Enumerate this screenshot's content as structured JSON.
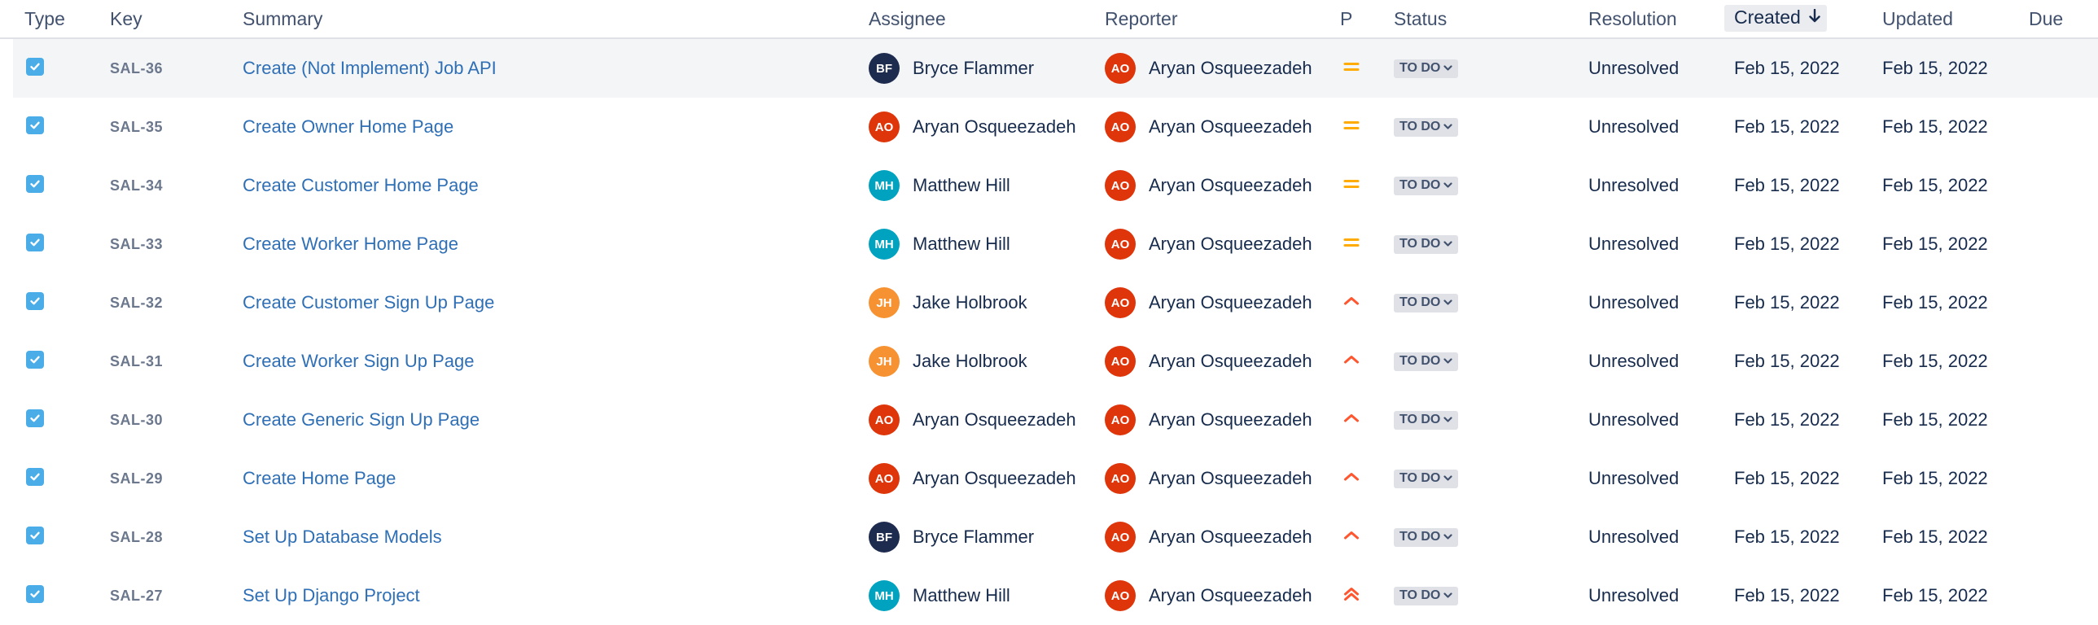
{
  "columns": {
    "type": "Type",
    "key": "Key",
    "summary": "Summary",
    "assignee": "Assignee",
    "reporter": "Reporter",
    "priority": "P",
    "status": "Status",
    "resolution": "Resolution",
    "created": "Created",
    "updated": "Updated",
    "due": "Due"
  },
  "sort": {
    "column": "created",
    "direction": "descending",
    "icon": "arrow-down-icon"
  },
  "colors": {
    "avatar_BF": "#1d2b4f",
    "avatar_AO": "#de350b",
    "avatar_MH": "#00a3bf",
    "avatar_JH": "#f79232",
    "priority_medium": "#ffab00",
    "priority_high": "#ff5630",
    "priority_highest": "#ff5630",
    "link": "#2f6fb5",
    "type_task": "#4bade8"
  },
  "issues": [
    {
      "type_icon": "task-checkbox-icon",
      "key": "SAL-36",
      "summary": "Create (Not Implement) Job API",
      "assignee": {
        "initials": "BF",
        "name": "Bryce Flammer"
      },
      "reporter": {
        "initials": "AO",
        "name": "Aryan Osqueezadeh"
      },
      "priority": "medium",
      "status": "TO DO",
      "resolution": "Unresolved",
      "created": "Feb 15, 2022",
      "updated": "Feb 15, 2022",
      "due": ""
    },
    {
      "type_icon": "task-checkbox-icon",
      "key": "SAL-35",
      "summary": "Create Owner Home Page",
      "assignee": {
        "initials": "AO",
        "name": "Aryan Osqueezadeh"
      },
      "reporter": {
        "initials": "AO",
        "name": "Aryan Osqueezadeh"
      },
      "priority": "medium",
      "status": "TO DO",
      "resolution": "Unresolved",
      "created": "Feb 15, 2022",
      "updated": "Feb 15, 2022",
      "due": ""
    },
    {
      "type_icon": "task-checkbox-icon",
      "key": "SAL-34",
      "summary": "Create Customer Home Page",
      "assignee": {
        "initials": "MH",
        "name": "Matthew Hill"
      },
      "reporter": {
        "initials": "AO",
        "name": "Aryan Osqueezadeh"
      },
      "priority": "medium",
      "status": "TO DO",
      "resolution": "Unresolved",
      "created": "Feb 15, 2022",
      "updated": "Feb 15, 2022",
      "due": ""
    },
    {
      "type_icon": "task-checkbox-icon",
      "key": "SAL-33",
      "summary": "Create Worker Home Page",
      "assignee": {
        "initials": "MH",
        "name": "Matthew Hill"
      },
      "reporter": {
        "initials": "AO",
        "name": "Aryan Osqueezadeh"
      },
      "priority": "medium",
      "status": "TO DO",
      "resolution": "Unresolved",
      "created": "Feb 15, 2022",
      "updated": "Feb 15, 2022",
      "due": ""
    },
    {
      "type_icon": "task-checkbox-icon",
      "key": "SAL-32",
      "summary": "Create Customer Sign Up Page",
      "assignee": {
        "initials": "JH",
        "name": "Jake Holbrook"
      },
      "reporter": {
        "initials": "AO",
        "name": "Aryan Osqueezadeh"
      },
      "priority": "high",
      "status": "TO DO",
      "resolution": "Unresolved",
      "created": "Feb 15, 2022",
      "updated": "Feb 15, 2022",
      "due": ""
    },
    {
      "type_icon": "task-checkbox-icon",
      "key": "SAL-31",
      "summary": "Create Worker Sign Up Page",
      "assignee": {
        "initials": "JH",
        "name": "Jake Holbrook"
      },
      "reporter": {
        "initials": "AO",
        "name": "Aryan Osqueezadeh"
      },
      "priority": "high",
      "status": "TO DO",
      "resolution": "Unresolved",
      "created": "Feb 15, 2022",
      "updated": "Feb 15, 2022",
      "due": ""
    },
    {
      "type_icon": "task-checkbox-icon",
      "key": "SAL-30",
      "summary": "Create Generic Sign Up Page",
      "assignee": {
        "initials": "AO",
        "name": "Aryan Osqueezadeh"
      },
      "reporter": {
        "initials": "AO",
        "name": "Aryan Osqueezadeh"
      },
      "priority": "high",
      "status": "TO DO",
      "resolution": "Unresolved",
      "created": "Feb 15, 2022",
      "updated": "Feb 15, 2022",
      "due": ""
    },
    {
      "type_icon": "task-checkbox-icon",
      "key": "SAL-29",
      "summary": "Create Home Page",
      "assignee": {
        "initials": "AO",
        "name": "Aryan Osqueezadeh"
      },
      "reporter": {
        "initials": "AO",
        "name": "Aryan Osqueezadeh"
      },
      "priority": "high",
      "status": "TO DO",
      "resolution": "Unresolved",
      "created": "Feb 15, 2022",
      "updated": "Feb 15, 2022",
      "due": ""
    },
    {
      "type_icon": "task-checkbox-icon",
      "key": "SAL-28",
      "summary": "Set Up Database Models",
      "assignee": {
        "initials": "BF",
        "name": "Bryce Flammer"
      },
      "reporter": {
        "initials": "AO",
        "name": "Aryan Osqueezadeh"
      },
      "priority": "high",
      "status": "TO DO",
      "resolution": "Unresolved",
      "created": "Feb 15, 2022",
      "updated": "Feb 15, 2022",
      "due": ""
    },
    {
      "type_icon": "task-checkbox-icon",
      "key": "SAL-27",
      "summary": "Set Up Django Project",
      "assignee": {
        "initials": "MH",
        "name": "Matthew Hill"
      },
      "reporter": {
        "initials": "AO",
        "name": "Aryan Osqueezadeh"
      },
      "priority": "highest",
      "status": "TO DO",
      "resolution": "Unresolved",
      "created": "Feb 15, 2022",
      "updated": "Feb 15, 2022",
      "due": ""
    }
  ]
}
